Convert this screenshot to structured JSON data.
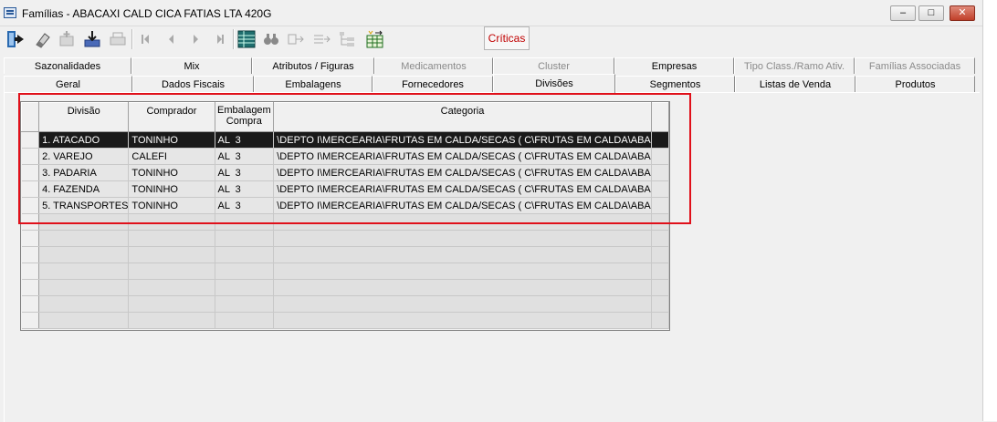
{
  "window": {
    "title": "Famílias - ABACAXI CALD CICA FATIAS LTA 420G",
    "minimize_glyph": "–",
    "maximize_glyph": "□",
    "close_glyph": "✕"
  },
  "toolbar": {
    "criticas_label": "Críticas",
    "icons": [
      "exit-icon",
      "eraser-icon",
      "add-record-icon",
      "download-icon",
      "print-icon",
      "first-record-icon",
      "previous-record-icon",
      "next-record-icon",
      "last-record-icon",
      "grid-view-icon",
      "binoculars-icon",
      "link-icon",
      "export-icon",
      "tree-icon",
      "table-settings-icon"
    ]
  },
  "tabs": {
    "row1": [
      "Sazonalidades",
      "Mix",
      "Atributos / Figuras",
      "Medicamentos",
      "Cluster",
      "Empresas",
      "Tipo Class./Ramo Ativ.",
      "Famílias Associadas"
    ],
    "row2": [
      "Geral",
      "Dados Fiscais",
      "Embalagens",
      "Fornecedores",
      "Divisões",
      "Segmentos",
      "Listas de Venda",
      "Produtos"
    ],
    "active": "Divisões",
    "disabled": [
      "Medicamentos",
      "Cluster",
      "Tipo Class./Ramo Ativ.",
      "Famílias Associadas"
    ]
  },
  "grid": {
    "columns": [
      "Divisão",
      "Comprador",
      "Embalagem Compra",
      "Categoria"
    ],
    "column_line1": [
      "Divisão",
      "Comprador",
      "Embalagem",
      "Categoria"
    ],
    "column_line2": [
      "",
      "",
      "Compra",
      ""
    ],
    "rows": [
      [
        "1. ATACADO",
        "TONINHO",
        "AL  3",
        "\\DEPTO I\\MERCEARIA\\FRUTAS EM CALDA/SECAS ( C\\FRUTAS EM CALDA\\ABA"
      ],
      [
        "2. VAREJO",
        "CALEFI",
        "AL  3",
        "\\DEPTO I\\MERCEARIA\\FRUTAS EM CALDA/SECAS ( C\\FRUTAS EM CALDA\\ABA"
      ],
      [
        "3. PADARIA",
        "TONINHO",
        "AL  3",
        "\\DEPTO I\\MERCEARIA\\FRUTAS EM CALDA/SECAS ( C\\FRUTAS EM CALDA\\ABA"
      ],
      [
        "4. FAZENDA",
        "TONINHO",
        "AL  3",
        "\\DEPTO I\\MERCEARIA\\FRUTAS EM CALDA/SECAS ( C\\FRUTAS EM CALDA\\ABA"
      ],
      [
        "5. TRANSPORTES",
        "TONINHO",
        "AL  3",
        "\\DEPTO I\\MERCEARIA\\FRUTAS EM CALDA/SECAS ( C\\FRUTAS EM CALDA\\ABA"
      ]
    ],
    "selected_row": 0,
    "highlight_color": "#e0101a"
  }
}
